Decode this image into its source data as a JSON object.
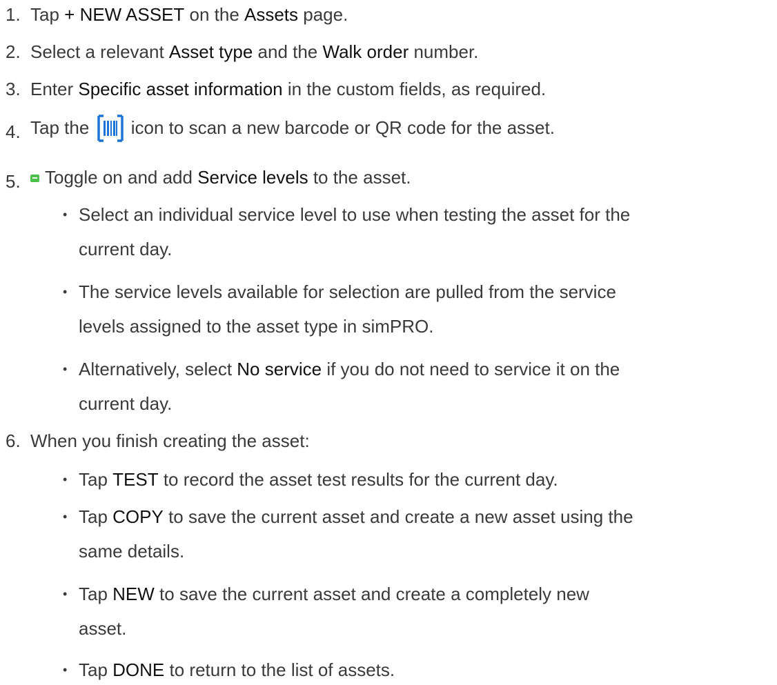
{
  "steps": [
    {
      "num": "1.",
      "parts": [
        "Tap ",
        "+ NEW ASSET",
        " on the ",
        "Assets",
        " page."
      ]
    },
    {
      "num": "2.",
      "parts": [
        "Select a relevant ",
        "Asset type",
        " and the ",
        "Walk order",
        " number."
      ]
    },
    {
      "num": "3.",
      "parts": [
        "Enter ",
        "Specific asset information",
        " in the custom fields, as required."
      ]
    },
    {
      "num": "4.",
      "parts": [
        "Tap the ",
        " icon to scan a new barcode or QR code for the asset."
      ],
      "icon": "barcode-scan-icon"
    },
    {
      "num": "5.",
      "parts": [
        "Toggle on and add ",
        "Service levels",
        " to the asset."
      ],
      "badge": "mp-badge-icon",
      "bullets": [
        {
          "lines": [
            "Select an individual service level to use when testing the asset for the",
            "current day."
          ]
        },
        {
          "lines": [
            "The service levels available for selection are pulled from the service",
            "levels assigned to the asset type in simPRO."
          ]
        },
        {
          "lines": [
            "Alternatively, select ",
            "No service",
            " if you do not need to service it on the",
            "current day."
          ]
        }
      ]
    },
    {
      "num": "6.",
      "parts": [
        "When you finish creating the asset:"
      ],
      "bullets": [
        {
          "parts": [
            "Tap ",
            "TEST",
            " to record the asset test results for the current day."
          ]
        },
        {
          "parts": [
            "Tap ",
            "COPY",
            " to save the current asset and create a new asset using the"
          ],
          "cont": "same details."
        },
        {
          "parts": [
            "Tap ",
            "NEW",
            " to save the current asset and create a completely new"
          ],
          "cont": "asset."
        },
        {
          "parts": [
            "Tap ",
            "DONE",
            " to return to the list of assets."
          ]
        }
      ]
    }
  ],
  "bullet_char": "•",
  "colors": {
    "text": "#3a3a3a",
    "bold": "#111111",
    "icon_blue": "#1e74d6",
    "badge_green": "#4cc24a"
  }
}
